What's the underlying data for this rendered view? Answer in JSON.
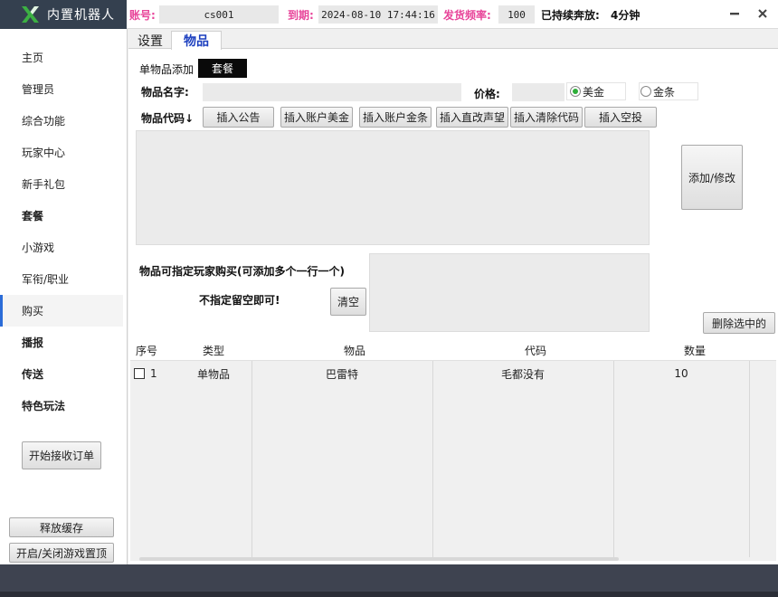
{
  "app": {
    "name": "内置机器人"
  },
  "titlebar": {
    "account_label": "账号:",
    "account_value": "cs001",
    "expire_label": "到期:",
    "expire_value": "2024-08-10 17:44:16",
    "rate_label": "发货频率:",
    "rate_value": "100",
    "running_label": "已持续奔放:",
    "running_value": "4分钟"
  },
  "sidebar": {
    "items": [
      {
        "label": "主页"
      },
      {
        "label": "管理员"
      },
      {
        "label": "综合功能"
      },
      {
        "label": "玩家中心"
      },
      {
        "label": "新手礼包"
      },
      {
        "label": "套餐"
      },
      {
        "label": "小游戏"
      },
      {
        "label": "军衔/职业"
      },
      {
        "label": "购买"
      },
      {
        "label": "播报"
      },
      {
        "label": "传送"
      },
      {
        "label": "特色玩法"
      }
    ],
    "active_index": 8,
    "start_orders_button": "开始接收订单",
    "release_cache_button": "释放缓存",
    "toggle_topmost_button": "开启/关闭游戏置顶"
  },
  "tabs": [
    {
      "label": "设置"
    },
    {
      "label": "物品"
    }
  ],
  "form": {
    "single_item_label": "单物品添加",
    "package_label": "套餐",
    "item_name_label": "物品名字:",
    "item_name_value": "",
    "price_label": "价格:",
    "price_value": "",
    "currency_usd": "美金",
    "currency_gold": "金条",
    "item_code_label": "物品代码↓",
    "insert_buttons": [
      "插入公告",
      "插入账户美金",
      "插入账户金条",
      "插入直改声望",
      "插入清除代码",
      "插入空投"
    ],
    "add_modify_button": "添加/修改",
    "buyer_label": "物品可指定玩家购买(可添加多个一行一个)",
    "no_assign_label": "不指定留空即可!",
    "clear_button": "清空",
    "delete_selected_button": "删除选中的"
  },
  "table": {
    "columns": [
      "序号",
      "类型",
      "物品",
      "代码",
      "数量"
    ],
    "rows": [
      {
        "index": "1",
        "type": "单物品",
        "item": "巴雷特",
        "code": "毛都没有",
        "qty": "10"
      }
    ]
  },
  "colors": {
    "accent_pink": "#e8459a",
    "logo_bg": "#34404f",
    "footer_bg": "#3e4350",
    "logo_green": "#3cb043"
  }
}
